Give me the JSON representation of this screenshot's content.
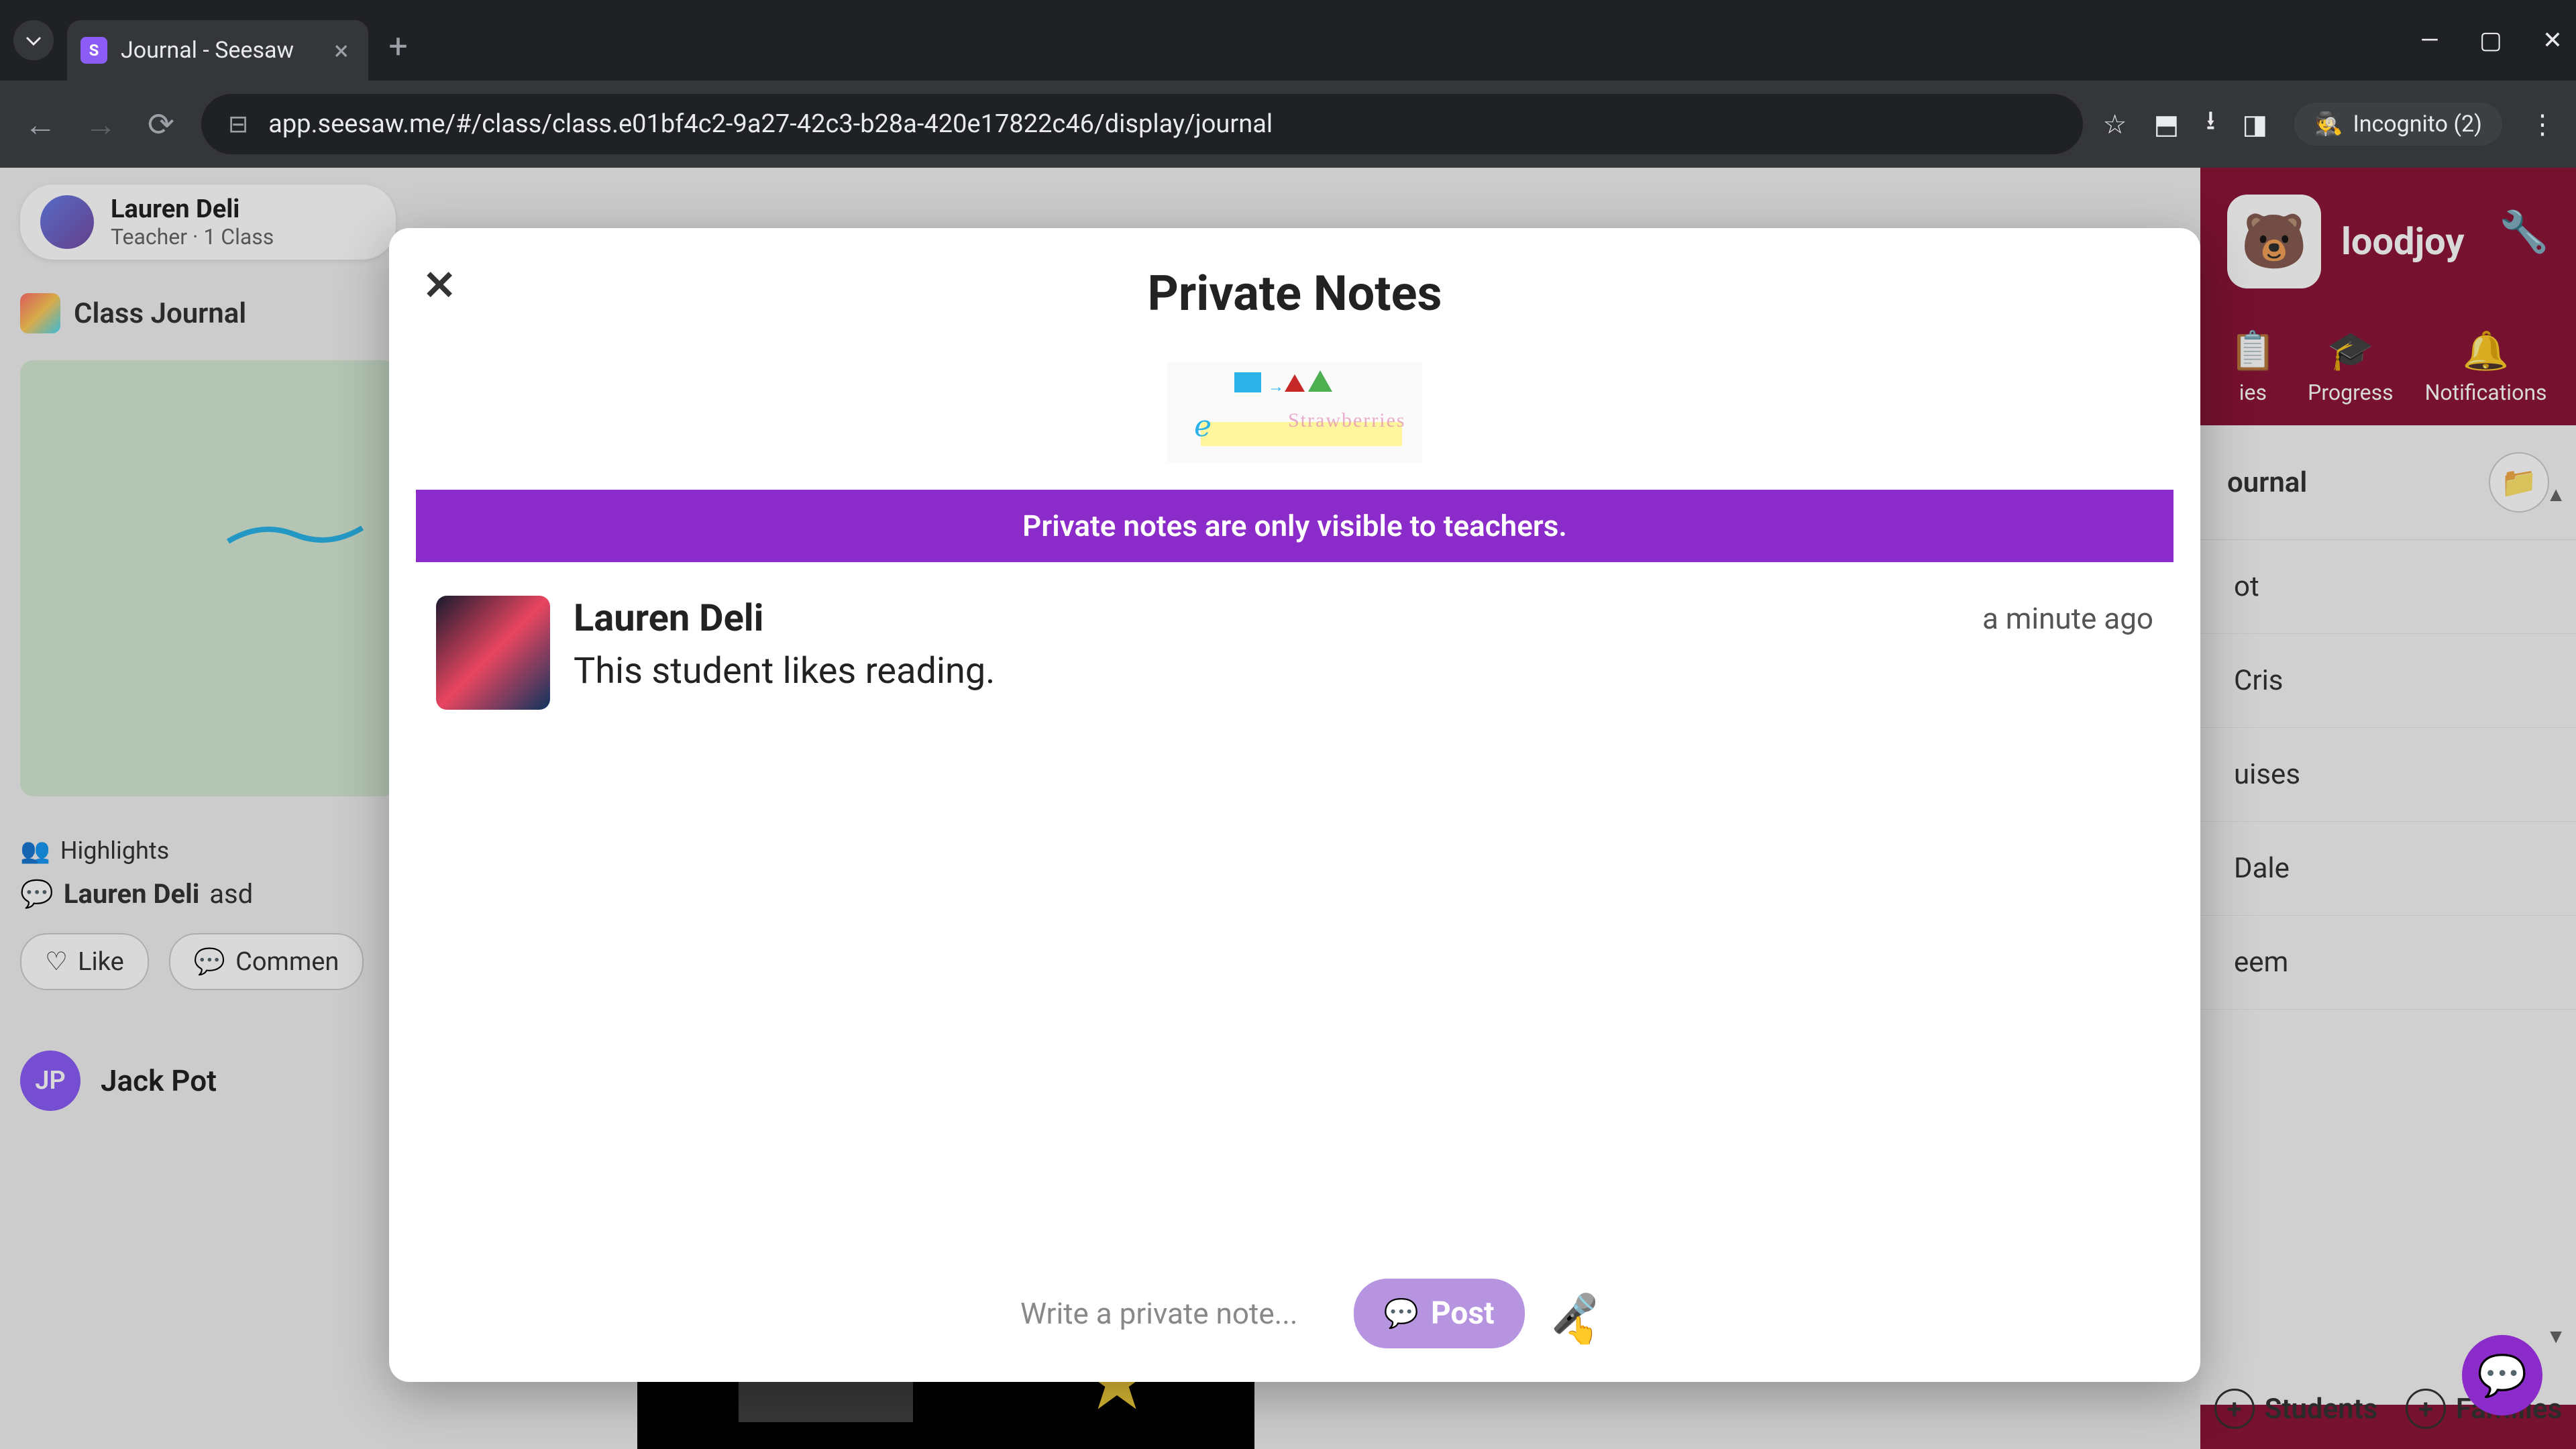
{
  "browser": {
    "tab_title": "Journal - Seesaw",
    "url": "app.seesaw.me/#/class/class.e01bf4c2-9a27-42c3-b28a-420e17822c46/display/journal",
    "incognito_label": "Incognito (2)"
  },
  "user": {
    "name": "Lauren Deli",
    "role": "Teacher · 1 Class"
  },
  "journal_label": "Class Journal",
  "post_meta": {
    "highlights": "Highlights",
    "commenter": "Lauren Deli",
    "comment_text": "asd",
    "like": "Like",
    "comment": "Commen"
  },
  "second_post": {
    "initials": "JP",
    "name": "Jack Pot"
  },
  "right": {
    "class_name": "loodjoy",
    "tabs": {
      "activities": "ies",
      "progress": "Progress",
      "notifications": "Notifications"
    },
    "list_header": "ournal",
    "items": [
      "ot",
      "Cris",
      "uises",
      "Dale",
      "eem"
    ],
    "students": "Students",
    "families": "Families"
  },
  "modal": {
    "title": "Private Notes",
    "banner": "Private notes are only visible to teachers.",
    "note": {
      "author": "Lauren Deli",
      "text": "This student likes reading.",
      "time": "a minute ago"
    },
    "input_placeholder": "Write a private note...",
    "post_label": "Post"
  }
}
